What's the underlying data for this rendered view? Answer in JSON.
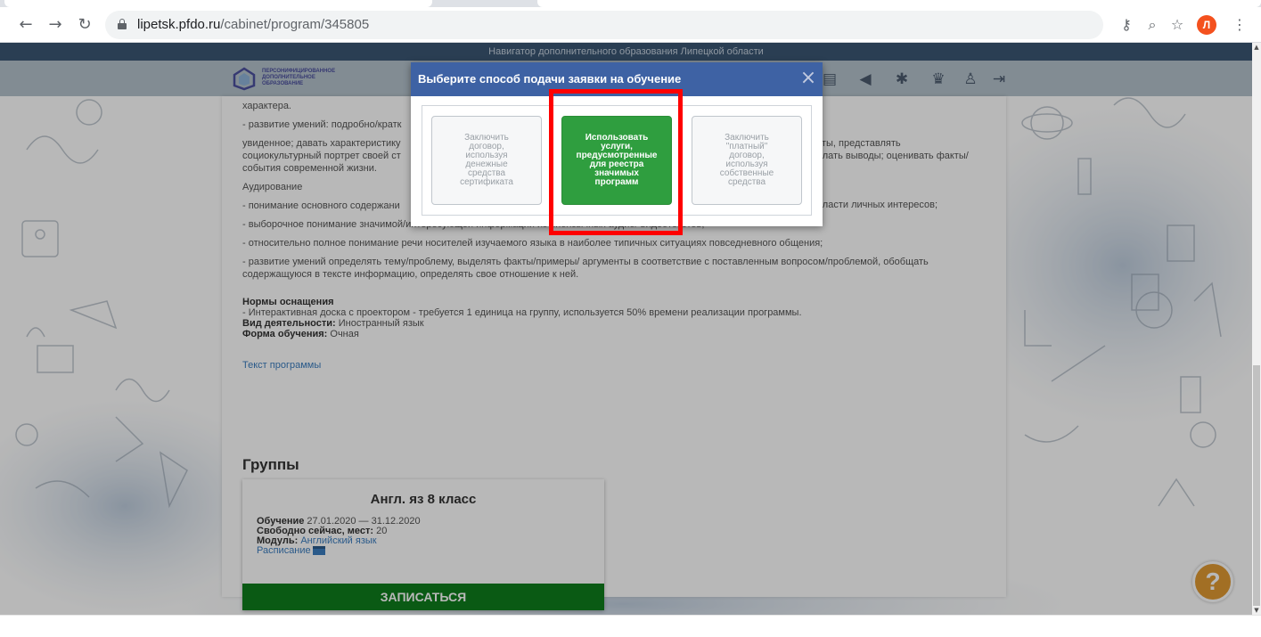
{
  "browser": {
    "url_host": "lipetsk.pfdo.ru",
    "url_path": "/cabinet/program/345805",
    "avatar_letter": "Л",
    "icons": [
      "back-icon",
      "forward-icon",
      "reload-icon",
      "lock-icon",
      "key-icon",
      "zoom-icon",
      "star-icon",
      "menu-icon"
    ]
  },
  "site": {
    "banner": "Навигатор дополнительного образования Липецкой области",
    "logo_text": "ПЕРСОНИФИЦИРОВАННОЕ ДОПОЛНИТЕЛЬНОЕ ОБРАЗОВАНИЕ",
    "header_icons": [
      "document-icon",
      "megaphone-icon",
      "snowflake-icon",
      "trophy-icon",
      "users-icon",
      "logout-icon"
    ]
  },
  "program": {
    "lines": [
      "характера.",
      "- развитие умений: подробно/кратк",
      "увиденное; давать характеристику",
      "социокультурный портрет своей ст",
      "события современной жизни.",
      "Аудирование",
      "- понимание основного содержани",
      "- выборочное понимание значимой/интересующей информации из иноязычных аудио/ видеотекстов;",
      "- относительно полное понимание речи носителей изучаемого языка в наиболее типичных ситуациях повседневного общения;",
      "- развитие умений определять тему/проблему, выделять факты/примеры/ аргументы в соответствие с поставленным вопросом/проблемой, обобщать содержащуюся в тексте информацию, определять свое отношение к ней."
    ],
    "right_fragments": [
      "кты, представлять",
      "елать выводы; оценивать факты/",
      "бласти личных интересов;"
    ],
    "equipment_label": "Нормы оснащения",
    "equipment_text": "- Интерактивная доска с проектором - требуется 1 единица на группу, используется 50% времени реализации программы.",
    "activity_label": "Вид деятельности:",
    "activity_value": "Иностранный язык",
    "form_label": "Форма обучения:",
    "form_value": "Очная",
    "program_text_link": "Текст программы"
  },
  "groups": {
    "title": "Группы",
    "card": {
      "name": "Англ. яз 8 класс",
      "study_label": "Обучение",
      "study_value": "27.01.2020 — 31.12.2020",
      "free_label": "Свободно сейчас, мест:",
      "free_value": "20",
      "module_label": "Модуль:",
      "module_value": "Английский язык",
      "schedule_link": "Расписание",
      "enroll_button": "ЗАПИСАТЬСЯ"
    }
  },
  "help_button": "?",
  "modal": {
    "title": "Выберите способ подачи заявки на обучение",
    "close": "×",
    "options": [
      "Заключить договор, используя денежные средства сертификата",
      "Использовать услуги, предусмотренные для реестра значимых программ",
      "Заключить \"платный\" договор, используя собственные средства"
    ],
    "highlighted_option": 1,
    "highlight_color": "#ff0000"
  }
}
